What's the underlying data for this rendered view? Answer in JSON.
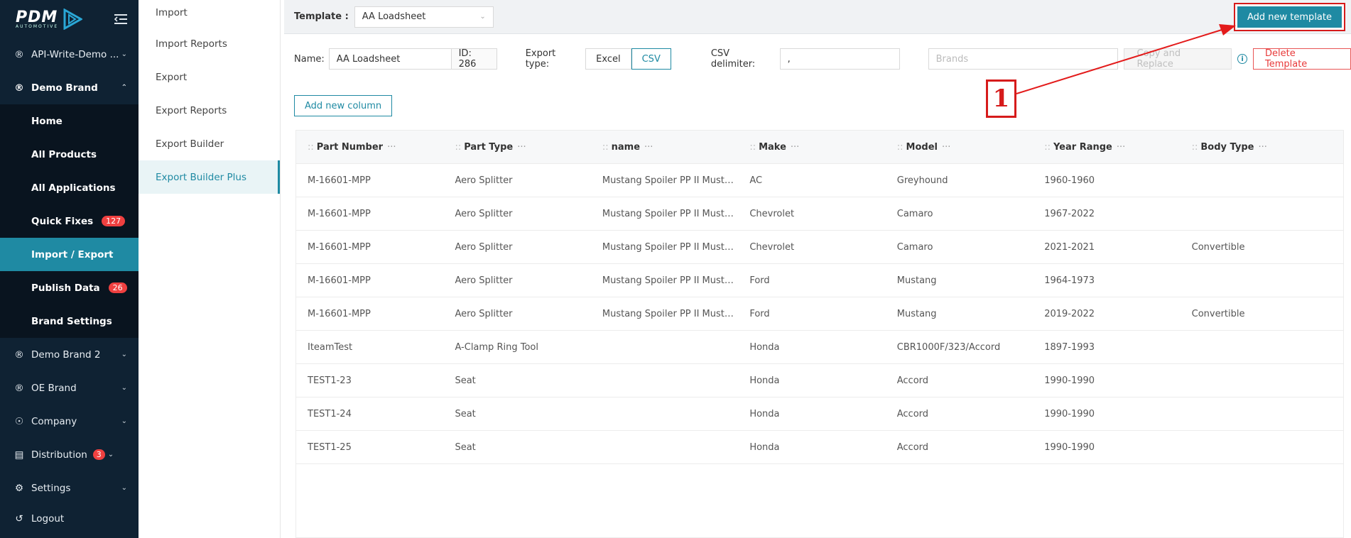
{
  "logo": {
    "text": "PDM",
    "sub": "AUTOMOTIVE"
  },
  "sidebar": {
    "items": [
      {
        "label": "API-Write-Demo ...",
        "icon": "registered-icon"
      },
      {
        "label": "Demo Brand",
        "icon": "registered-icon"
      }
    ],
    "sub_items": [
      {
        "label": "Home"
      },
      {
        "label": "All Products"
      },
      {
        "label": "All Applications"
      },
      {
        "label": "Quick Fixes",
        "badge": "127"
      },
      {
        "label": "Import / Export"
      },
      {
        "label": "Publish Data",
        "badge": "26"
      },
      {
        "label": "Brand Settings"
      }
    ],
    "bottom_items": [
      {
        "label": "Demo Brand 2"
      },
      {
        "label": "OE Brand"
      },
      {
        "label": "Company"
      },
      {
        "label": "Distribution",
        "badge": "3"
      },
      {
        "label": "Settings"
      },
      {
        "label": "Logout"
      }
    ]
  },
  "submenu": {
    "items": [
      "Import",
      "Import Reports",
      "Export",
      "Export Reports",
      "Export Builder",
      "Export Builder Plus"
    ]
  },
  "topbar": {
    "template_label": "Template :",
    "template_value": "AA Loadsheet",
    "add_template_label": "Add new template"
  },
  "filters": {
    "name_label": "Name:",
    "name_value": "AA Loadsheet",
    "id_value": "ID: 286",
    "export_type_label": "Export type:",
    "export_types": [
      "Excel",
      "CSV"
    ],
    "csv_delimiter_label": "CSV delimiter:",
    "csv_delimiter_value": ",",
    "brands_placeholder": "Brands",
    "copy_replace_label": "Copy and Replace",
    "delete_label": "Delete Template"
  },
  "toolbar": {
    "add_column_label": "Add new column"
  },
  "table": {
    "headers": [
      "Part Number",
      "Part Type",
      "name",
      "Make",
      "Model",
      "Year Range",
      "Body Type"
    ],
    "rows": [
      [
        "M-16601-MPP",
        "Aero Splitter",
        "Mustang Spoiler PP II Mustang Spoiler",
        "AC",
        "Greyhound",
        "1960-1960",
        ""
      ],
      [
        "M-16601-MPP",
        "Aero Splitter",
        "Mustang Spoiler PP II Mustang Spoiler",
        "Chevrolet",
        "Camaro",
        "1967-2022",
        ""
      ],
      [
        "M-16601-MPP",
        "Aero Splitter",
        "Mustang Spoiler PP II Mustang Spoiler",
        "Chevrolet",
        "Camaro",
        "2021-2021",
        "Convertible"
      ],
      [
        "M-16601-MPP",
        "Aero Splitter",
        "Mustang Spoiler PP II Mustang Spoiler",
        "Ford",
        "Mustang",
        "1964-1973",
        ""
      ],
      [
        "M-16601-MPP",
        "Aero Splitter",
        "Mustang Spoiler PP II Mustang Spoiler",
        "Ford",
        "Mustang",
        "2019-2022",
        "Convertible"
      ],
      [
        "IteamTest",
        "A-Clamp Ring Tool",
        "",
        "Honda",
        "CBR1000F/323/Accord",
        "1897-1993",
        ""
      ],
      [
        "TEST1-23",
        "Seat",
        "",
        "Honda",
        "Accord",
        "1990-1990",
        ""
      ],
      [
        "TEST1-24",
        "Seat",
        "",
        "Honda",
        "Accord",
        "1990-1990",
        ""
      ],
      [
        "TEST1-25",
        "Seat",
        "",
        "Honda",
        "Accord",
        "1990-1990",
        ""
      ]
    ]
  },
  "annotation": {
    "step_number": "1",
    "color": "#d61b1b"
  }
}
